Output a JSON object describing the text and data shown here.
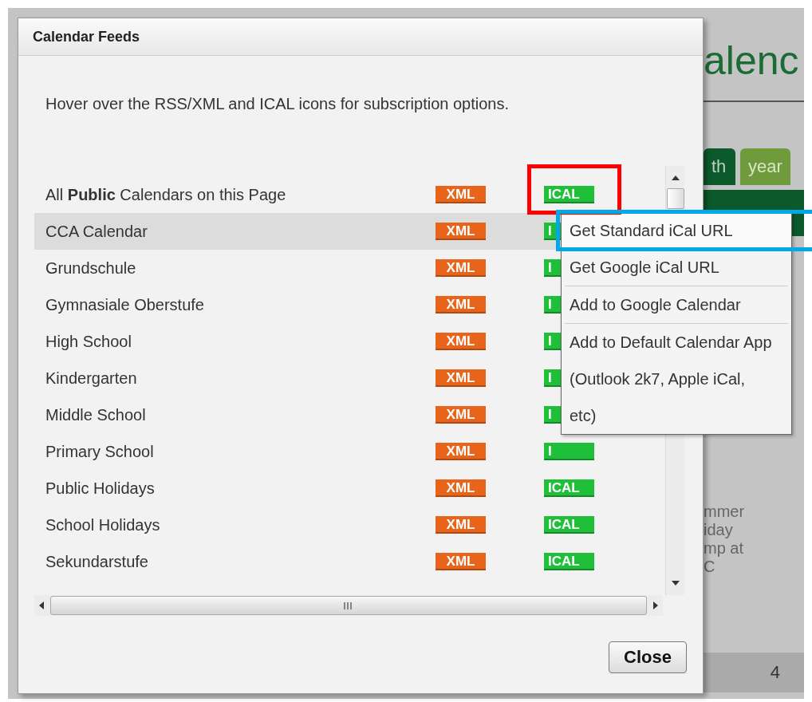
{
  "background_page": {
    "heading": "alenc",
    "tabs": [
      {
        "label": "th",
        "selected": true
      },
      {
        "label": "year",
        "selected": false
      }
    ],
    "event_text": "mmer\niday\nmp at\nC",
    "day_number": "4"
  },
  "dialog": {
    "title": "Calendar Feeds",
    "intro": "Hover over the RSS/XML and ICAL icons for subscription options.",
    "feeds": [
      {
        "name": "All **Public** Calendars on this Page",
        "xml": "XML",
        "ical": "ICAL",
        "selected": false,
        "highlighted": true
      },
      {
        "name": "CCA Calendar",
        "xml": "XML",
        "ical": "I",
        "selected": true,
        "highlighted": false
      },
      {
        "name": "Grundschule",
        "xml": "XML",
        "ical": "I",
        "selected": false,
        "highlighted": false
      },
      {
        "name": "Gymnasiale Oberstufe",
        "xml": "XML",
        "ical": "I",
        "selected": false,
        "highlighted": false
      },
      {
        "name": "High School",
        "xml": "XML",
        "ical": "I",
        "selected": false,
        "highlighted": false
      },
      {
        "name": "Kindergarten",
        "xml": "XML",
        "ical": "I",
        "selected": false,
        "highlighted": false
      },
      {
        "name": "Middle School",
        "xml": "XML",
        "ical": "I",
        "selected": false,
        "highlighted": false
      },
      {
        "name": "Primary School",
        "xml": "XML",
        "ical": "I",
        "selected": false,
        "highlighted": false
      },
      {
        "name": "Public Holidays",
        "xml": "XML",
        "ical": "ICAL",
        "selected": false,
        "highlighted": false
      },
      {
        "name": "School Holidays",
        "xml": "XML",
        "ical": "ICAL",
        "selected": false,
        "highlighted": false
      },
      {
        "name": "Sekundarstufe",
        "xml": "XML",
        "ical": "ICAL",
        "selected": false,
        "highlighted": false
      }
    ],
    "close_button": "Close"
  },
  "menu": {
    "items": [
      {
        "label": "Get Standard iCal URL",
        "selected": true,
        "divider_before": false
      },
      {
        "label": "Get Google iCal URL",
        "selected": false,
        "divider_before": false
      },
      {
        "label": "Add to Google Calendar",
        "selected": false,
        "divider_before": true
      },
      {
        "label": "Add to Default Calendar App (Outlook 2k7, Apple iCal, etc)",
        "selected": false,
        "divider_before": true
      }
    ]
  }
}
